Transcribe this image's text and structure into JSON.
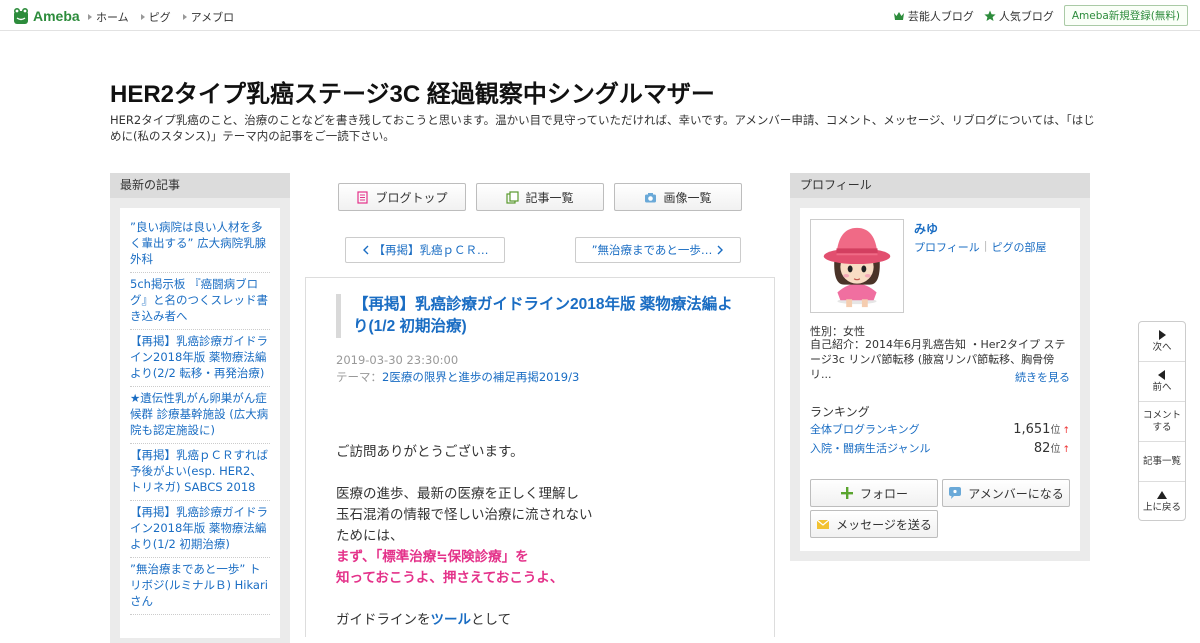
{
  "global_header": {
    "logo_text": "Ameba",
    "nav": [
      "ホーム",
      "ピグ",
      "アメブロ"
    ],
    "right_links": [
      "芸能人ブログ",
      "人気ブログ"
    ],
    "register_label": "Ameba新規登録(無料)"
  },
  "blog": {
    "title": "HER2タイプ乳癌ステージ3C 経過観察中シングルマザー",
    "description": "HER2タイプ乳癌のこと、治療のことなどを書き残しておこうと思います。温かい目で見守っていただければ、幸いです。アメンバー申請、コメント、メッセージ、リブログについては、「はじめに(私のスタンス)」テーマ内の記事をご一読下さい。"
  },
  "left_sidebar": {
    "heading": "最新の記事",
    "articles": [
      "”良い病院は良い人材を多く輩出する” 広大病院乳腺外科",
      "5ch掲示板 『癌闘病ブログ』と名のつくスレッド書き込み者へ",
      "【再掲】乳癌診療ガイドライン2018年版 薬物療法編より(2/2 転移・再発治療)",
      "★遺伝性乳がん卵巣がん症候群 診療基幹施設 (広大病院も認定施設に)",
      "【再掲】乳癌ｐＣＲすれば予後がよい(esp. HER2、トリネガ) SABCS 2018",
      "【再掲】乳癌診療ガイドライン2018年版 薬物療法編より(1/2 初期治療)",
      "”無治療まであと一歩” トリボジ(ルミナルＢ) Hikariさん"
    ]
  },
  "center": {
    "nav_buttons": [
      "ブログトップ",
      "記事一覧",
      "画像一覧"
    ],
    "prev_label": "【再掲】乳癌ｐＣＲ…",
    "next_label": "”無治療まであと一歩…",
    "article": {
      "title": "【再掲】乳癌診療ガイドライン2018年版 薬物療法編より(1/2 初期治療)",
      "date": "2019-03-30 23:30:00",
      "theme_prefix": "テーマ：",
      "theme": "2医療の限界と進歩の補足再掲2019/3",
      "p1": "ご訪問ありがとうございます。",
      "p2": "医療の進歩、最新の医療を正しく理解し",
      "p3": "玉石混淆の情報で怪しい治療に流されない",
      "p4": "ためには、",
      "pink1": "まず、「標準治療≒保険診療」を",
      "pink2": "知っておこうよ、押さえておこうよ、",
      "p5a": "ガイドラインを",
      "p5b": "ツール",
      "p5c": "として"
    }
  },
  "profile": {
    "heading": "プロフィール",
    "name": "みゆ",
    "link_profile": "プロフィール",
    "link_pig": "ピグの部屋",
    "gender": "性別：女性",
    "intro": "自己紹介：2014年6月乳癌告知 ・Her2タイプ ステージ3c リンパ節転移 (腋窩リンパ節転移、胸骨傍リ...",
    "more": "続きを見る",
    "ranking_title": "ランキング",
    "rankings": [
      {
        "name": "全体ブログランキング",
        "value": "1,651",
        "unit": "位",
        "arrow": "↑"
      },
      {
        "name": "入院・闘病生活ジャンル",
        "value": "82",
        "unit": "位",
        "arrow": "↑"
      }
    ],
    "buttons": {
      "follow": "フォロー",
      "amember": "アメンバーになる",
      "message": "メッセージを送る"
    }
  },
  "side_nav": {
    "next": "次へ",
    "prev": "前へ",
    "comment1": "コメント",
    "comment2": "する",
    "list": "記事一覧",
    "top": "上に戻る"
  },
  "colors": {
    "link": "#1a6dc3",
    "brand": "#2d8c3c",
    "emphasis_pink": "#e4328a"
  }
}
